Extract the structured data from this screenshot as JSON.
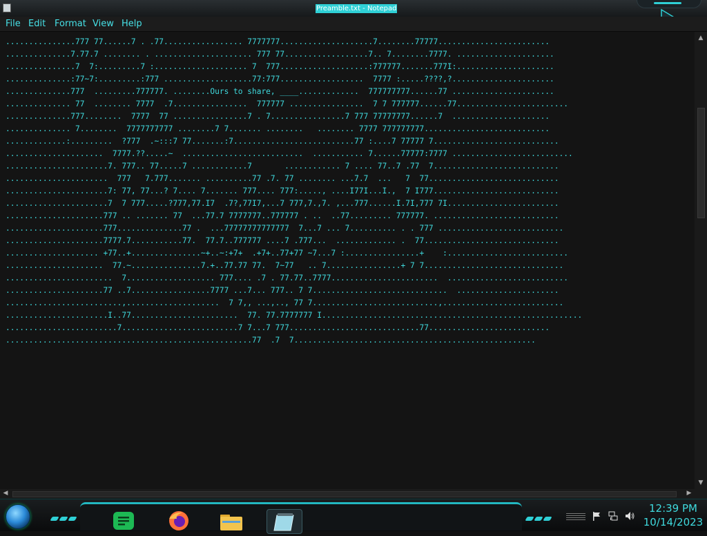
{
  "window": {
    "title": "Preamble.txt - Notepad"
  },
  "menu": [
    "File",
    "Edit",
    "Format",
    "View",
    "Help"
  ],
  "document_text": "...............777 77......7 . .77................. 7777777....................7........77777........................\n..............7.77.7 ........ . ..................... 777 77..................7.. 7........7777. .....................\n...............7  7:.........7 :.................... 7  777...................:777777.......777I:.....................\n..............:77~7:.........:777 ...................77:777..................  7777 :.....????,?......................\n..............777  .........777777. ........Ours to share, ____.............  777777777......77 ......................\n.............. 77  ........ 7777  .7................  777777 ................  7 7 777777......77........................\n..............777........  7777  77 ................7 . 7................7 777 77777777......7  .....................\n.............. 7........  7777777777 ........7 7....... ........   ........ 7777 777777777...........................\n.............:.........  ?777  .~:::7 77.......:7..........................77 :....7 77777 7...........................\n.....................  7777.??.....~  ..........................  ........... 7......77777:7777 ..........................\n......................7. 777.. 77.....7 ............7       ............ 7 .... 77..7 .77  7...........................\n......................  777   7.777....... ..........77 .7. 77 ........ ...7.7  ...   7  77............................\n......................7: 77, 77...? 7.... 7....... 777.... 777:....., ....I77I...I.,  7 I777...........................\n......................7  7 777.....?777,77.I7  .7?,77I7,...7 777,7.,7. ,...777......I.7I,777 7I........................\n.....................777 .. ....... 77  ...77.7 7777777..777777 . ..  ..77......... 777777. ...........................\n.....................777..............77 .  ...77777777777777  7...7 ... 7.......... . . 777 ...........................\n.....................7777.7...........77.  77.7..777777 ....7 .777...  ............. .  77.............................\n.................... +77..+...............~+..~:+7+  .+7+..77+77 ~7...7 :................+    :..........................\n.....................  77.~...............7.+..77.77 77.  7~77   .. 7................+ 7 7..............................\n.......................  7................... 777.... .7 . 77.77..7777.......................  ..........................\n.....................77 ..7.................7777 ...7... 777.. 7 7.............................  ......................\n.........................,....................  7 7,, ...,.., 77 7...........................,..........................\n......................I..77.......................  77. 77.7777777 I........................................................\n........................7.........................7 7...7 777............................77..........................\n.....................................................77  .7  7....................................................",
  "taskbar": {
    "time": "12:39 PM",
    "date": "10/14/2023",
    "apps": [
      {
        "name": "Spotify",
        "color": "#1db954"
      },
      {
        "name": "Firefox",
        "color": "#ff7139"
      },
      {
        "name": "File Explorer",
        "color": "#f3c44d"
      },
      {
        "name": "Notepad",
        "color": "#9fd9e8"
      }
    ]
  },
  "theme": {
    "accent": "#3fd9dd",
    "title_highlight": "#2fd0d6",
    "background": "#141414"
  }
}
